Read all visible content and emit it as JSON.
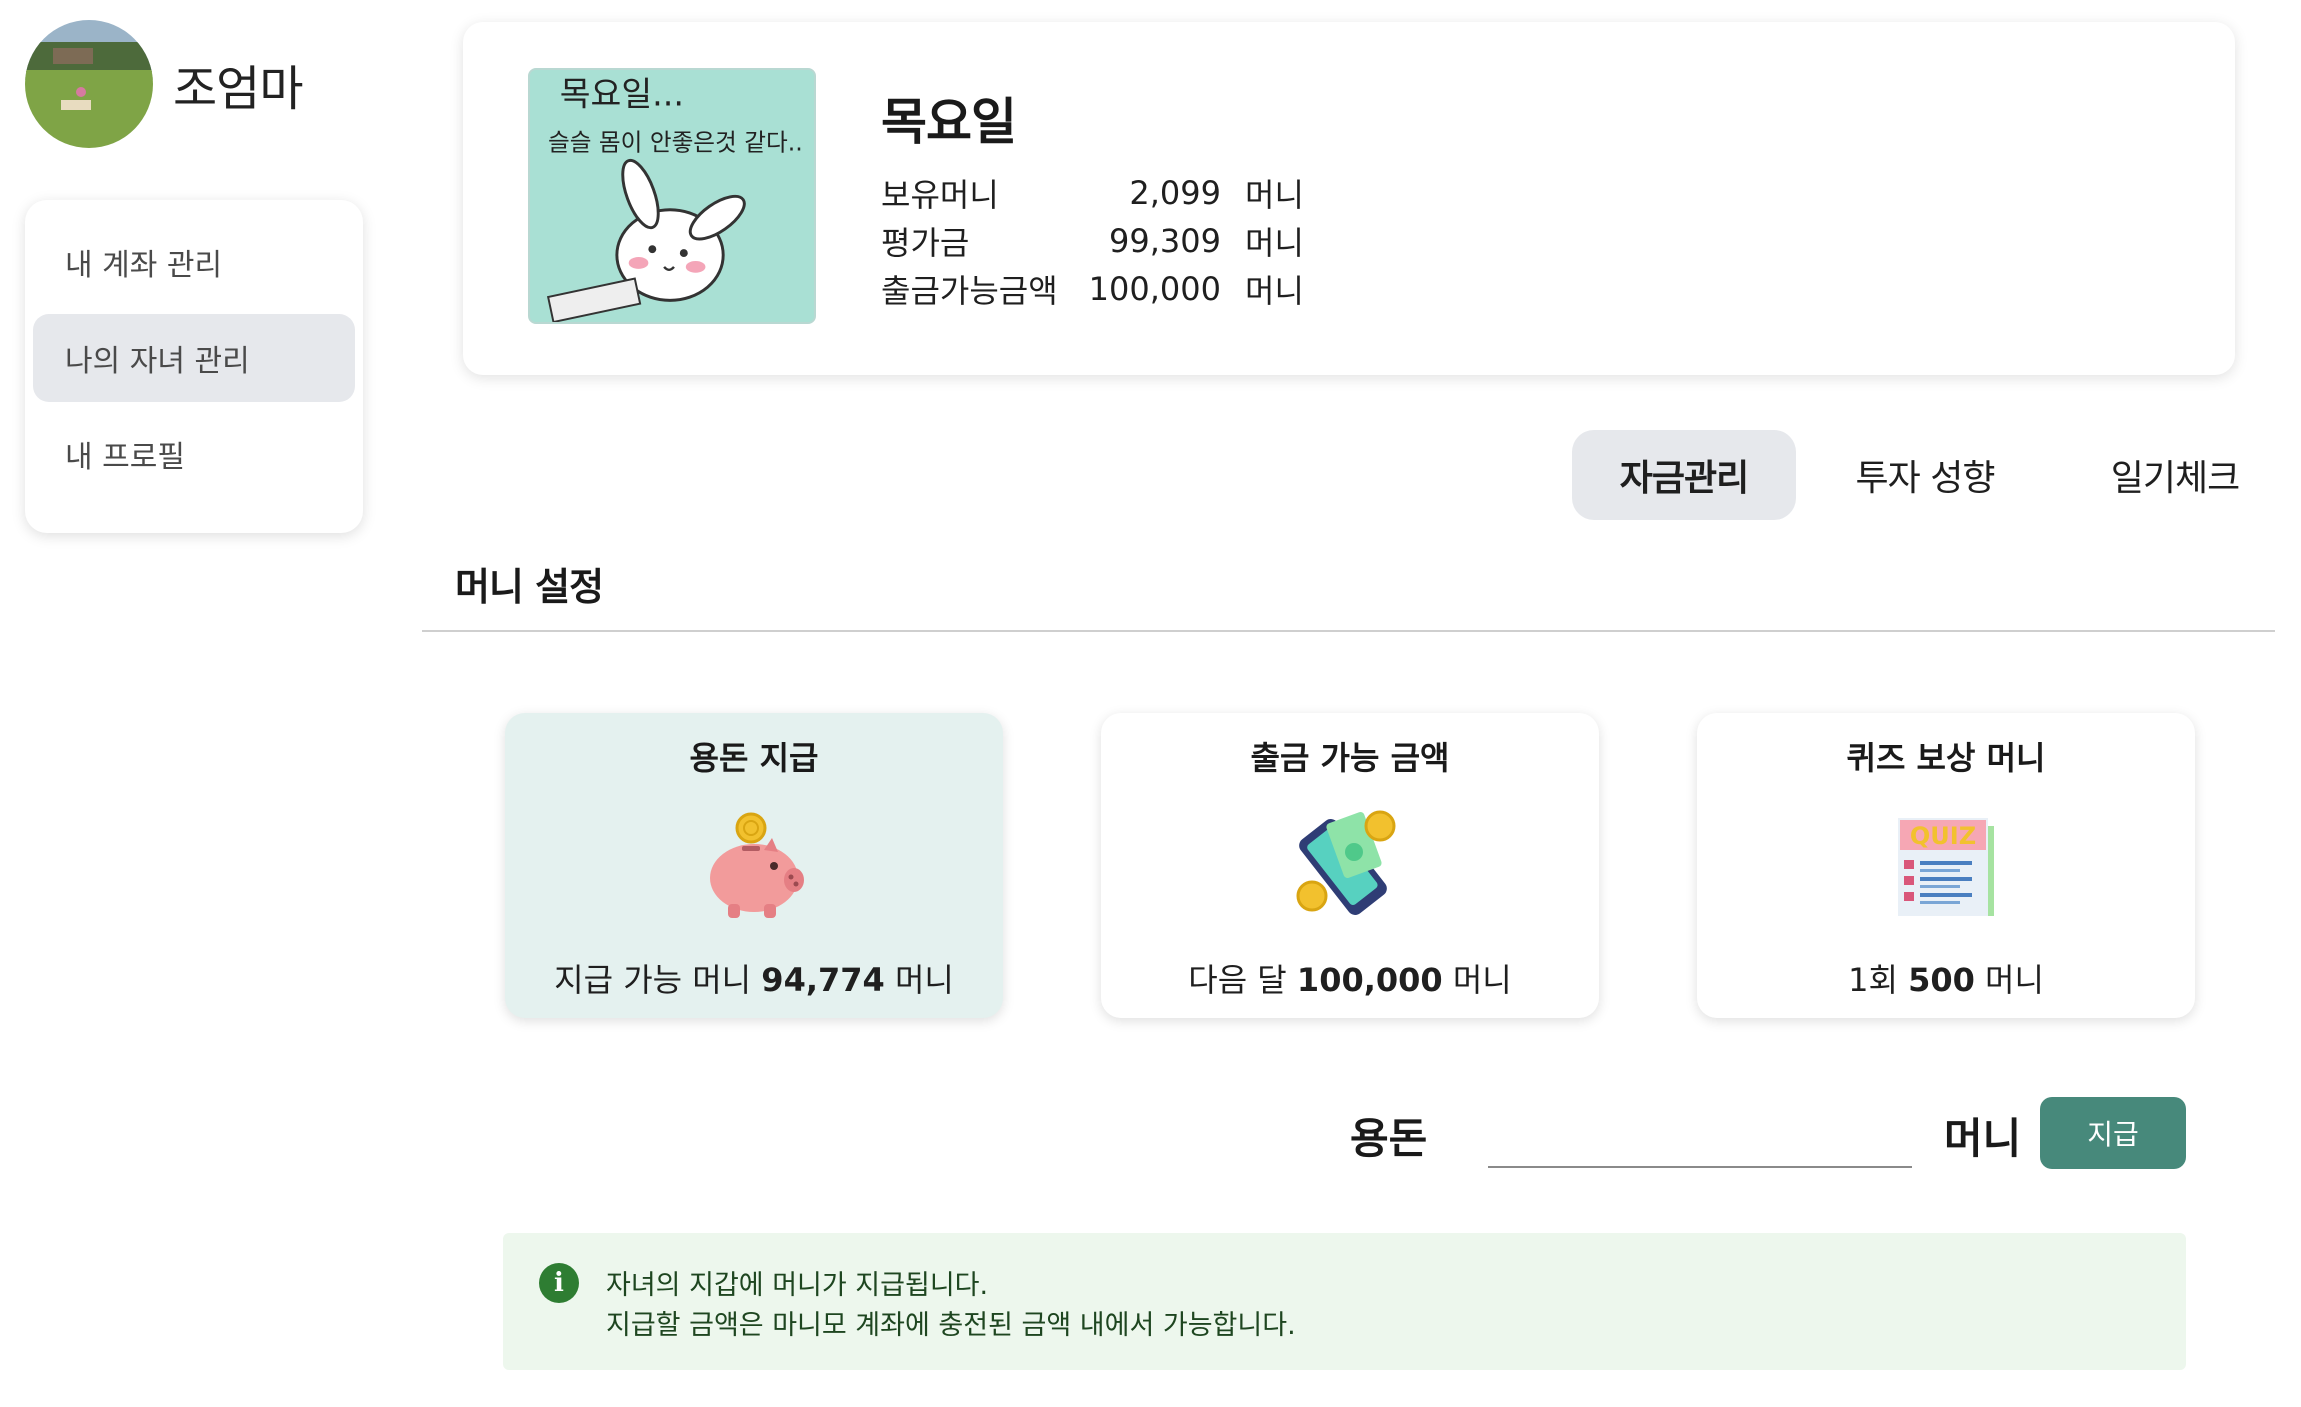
{
  "user": {
    "name": "조엄마"
  },
  "sidebar": {
    "items": [
      {
        "label": "내 계좌 관리",
        "active": false
      },
      {
        "label": "나의 자녀 관리",
        "active": true
      },
      {
        "label": "내 프로필",
        "active": false
      }
    ]
  },
  "child": {
    "name": "목요일",
    "image_text": [
      "목요일...",
      "슬슬 몸이 안좋은것 같다.."
    ],
    "stats": [
      {
        "label": "보유머니",
        "value": "2,099",
        "unit": "머니"
      },
      {
        "label": "평가금",
        "value": "99,309",
        "unit": "머니"
      },
      {
        "label": "출금가능금액",
        "value": "100,000",
        "unit": "머니"
      }
    ]
  },
  "tabs": [
    {
      "label": "자금관리",
      "active": true
    },
    {
      "label": "투자 성향",
      "active": false
    },
    {
      "label": "일기체크",
      "active": false
    }
  ],
  "section": {
    "title": "머니 설정"
  },
  "cards": [
    {
      "title": "용돈 지급",
      "icon": "piggy-bank-icon",
      "prefix": "지급 가능 머니 ",
      "amount": "94,774",
      "suffix": " 머니",
      "selected": true
    },
    {
      "title": "출금 가능 금액",
      "icon": "phone-money-icon",
      "prefix": "다음 달 ",
      "amount": "100,000",
      "suffix": " 머니",
      "selected": false
    },
    {
      "title": "퀴즈 보상 머니",
      "icon": "quiz-icon",
      "prefix": "1회 ",
      "amount": "500",
      "suffix": " 머니",
      "selected": false,
      "icon_text": "QUIZ"
    }
  ],
  "allowance": {
    "label": "용돈",
    "unit": "머니",
    "value": "",
    "button": "지급"
  },
  "info": {
    "icon": "info-icon",
    "lines": [
      "자녀의 지갑에 머니가 지급됩니다.",
      "지급할 금액은 마니모 계좌에 충전된 금액 내에서 가능합니다."
    ]
  },
  "colors": {
    "accent": "#47897b",
    "selected_card": "#e4f1ef",
    "info_bg": "#edf7ed",
    "info_icon": "#2e7d32"
  }
}
